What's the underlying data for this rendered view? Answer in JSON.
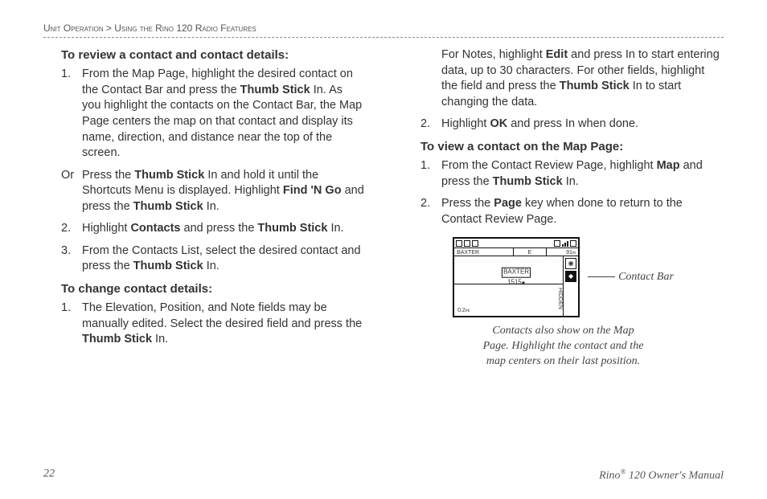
{
  "breadcrumb": {
    "section": "Unit Operation",
    "sep": " > ",
    "sub": "Using the Rino 120 Radio Features"
  },
  "left": {
    "title1": "To review a contact and contact details:",
    "s1_num": "1.",
    "s1_a": "From the Map Page, highlight the desired contact on the Contact Bar and press the ",
    "s1_b": "Thumb Stick",
    "s1_c": " In. As you highlight the contacts on the Contact Bar, the Map Page centers the map on that contact and display its name, direction, and distance near the top of the screen.",
    "or_num": "Or",
    "or_a": "Press the ",
    "or_b": "Thumb Stick",
    "or_c": " In and hold it until the Shortcuts Menu is displayed. Highlight ",
    "or_d": "Find 'N Go",
    "or_e": " and press the ",
    "or_f": "Thumb Stick",
    "or_g": " In.",
    "s2_num": "2.",
    "s2_a": "Highlight ",
    "s2_b": "Contacts",
    "s2_c": " and press the ",
    "s2_d": "Thumb Stick",
    "s2_e": " In.",
    "s3_num": "3.",
    "s3_a": "From the Contacts List, select the desired contact and press the ",
    "s3_b": "Thumb Stick",
    "s3_c": " In.",
    "title2": "To change contact details:",
    "c1_num": "1.",
    "c1_a": "The Elevation, Position, and Note fields may be manually edited. Select the desired field and press the ",
    "c1_b": "Thumb Stick",
    "c1_c": " In."
  },
  "right": {
    "cont_a": "For Notes, highlight ",
    "cont_b": "Edit",
    "cont_c": " and press In to start entering data, up to 30 characters. For other fields, highlight the field and press the ",
    "cont_d": "Thumb Stick",
    "cont_e": " In to start changing the data.",
    "r2_num": "2.",
    "r2_a": "Highlight ",
    "r2_b": "OK",
    "r2_c": " and press In when done.",
    "title3": "To view a contact on the Map Page:",
    "v1_num": "1.",
    "v1_a": "From the Contact Review Page, highlight ",
    "v1_b": "Map",
    "v1_c": " and press the ",
    "v1_d": "Thumb Stick",
    "v1_e": " In.",
    "v2_num": "2.",
    "v2_a": "Press the ",
    "v2_b": "Page",
    "v2_c": " key when done to return to the Contact Review Page.",
    "callout": "Contact Bar",
    "caption1": "Contacts also show on the Map",
    "caption2": "Page. Highlight the contact and the",
    "caption3": "map centers on their last position."
  },
  "figure": {
    "baxter": "BAXTER",
    "dir": "E",
    "dist": "91",
    "unit": "m",
    "center": "BAXTER",
    "center_num": "1515",
    "scale": "0.2",
    "hidden": "HIDDEN"
  },
  "footer": {
    "page": "22",
    "title_a": "Rino",
    "title_sup": "®",
    "title_b": " 120 Owner's Manual"
  }
}
